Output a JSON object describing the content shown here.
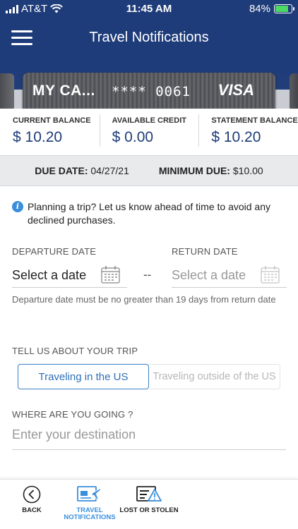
{
  "status_bar": {
    "carrier": "AT&T",
    "time": "11:45 AM",
    "battery": "84%",
    "battery_level": 0.84
  },
  "header": {
    "title": "Travel Notifications",
    "menu_icon": "hamburger-menu-icon"
  },
  "card": {
    "name": "MY CA...",
    "number": "**** 0061",
    "brand": "VISA"
  },
  "balances": [
    {
      "label": "CURRENT BALANCE",
      "value": "$ 10.20"
    },
    {
      "label": "AVAILABLE CREDIT",
      "value": "$ 0.00"
    },
    {
      "label": "STATEMENT BALANCE",
      "value": "$ 10.20"
    }
  ],
  "due": {
    "due_date_label": "DUE DATE:",
    "due_date_value": "04/27/21",
    "min_due_label": "MINIMUM DUE:",
    "min_due_value": "$10.00"
  },
  "info": {
    "icon": "info-icon",
    "text": "Planning a trip? Let us know ahead of time to avoid any declined purchases."
  },
  "dates": {
    "departure_label": "DEPARTURE DATE",
    "departure_value": "Select a date",
    "separator": "--",
    "return_label": "RETURN DATE",
    "return_value": "Select a date",
    "calendar_icon": "calendar-icon",
    "hint": "Departure date must be no greater than 19 days from return date"
  },
  "trip": {
    "label": "TELL US ABOUT YOUR TRIP",
    "options": [
      "Traveling in the US",
      "Traveling outside of the US"
    ],
    "selected": "Traveling in the US"
  },
  "destination": {
    "label": "WHERE ARE YOU GOING ?",
    "placeholder": "Enter your destination",
    "value": ""
  },
  "tabbar": {
    "items": [
      {
        "label": "BACK",
        "icon": "back-arrow-icon",
        "active": false
      },
      {
        "label": "TRAVEL NOTIFICATIONS",
        "icon": "travel-notifications-icon",
        "active": true
      },
      {
        "label": "LOST OR STOLEN",
        "icon": "lost-stolen-icon",
        "active": false
      }
    ]
  },
  "colors": {
    "header_bg": "#1f3c7a",
    "accent_blue": "#3a8fdc",
    "balance_value": "#1f3c7a",
    "battery_green": "#4cd964"
  }
}
